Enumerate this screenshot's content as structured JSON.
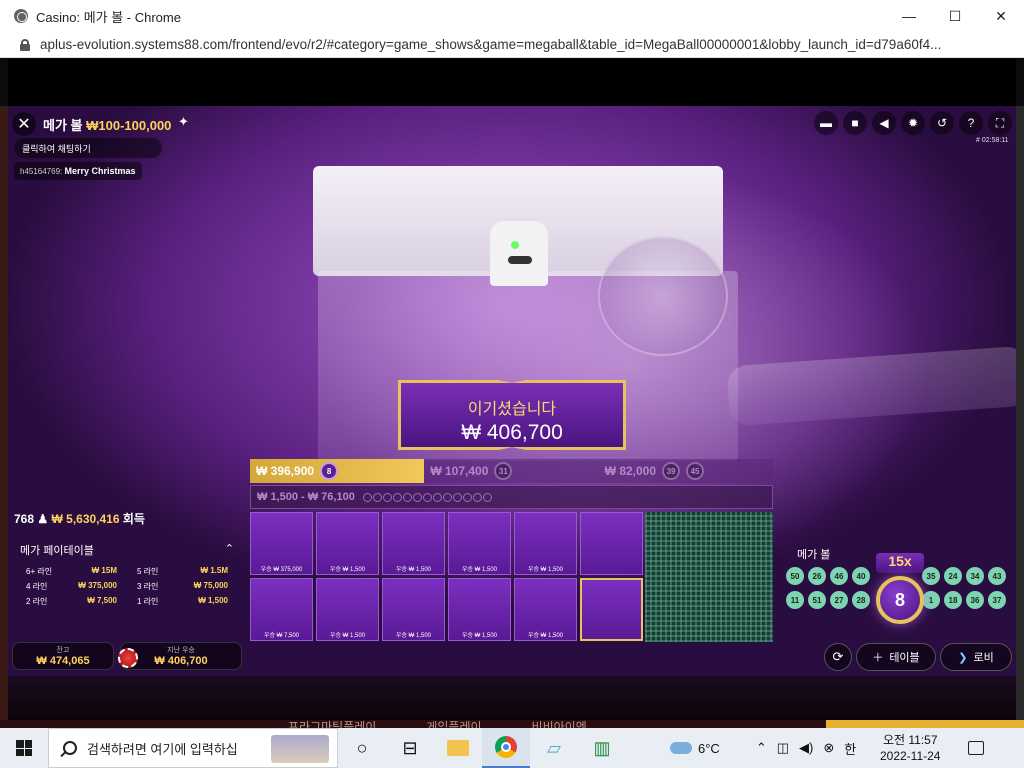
{
  "window": {
    "title": "Casino: 메가 볼 - Chrome",
    "url": "aplus-evolution.systems88.com/frontend/evo/r2/#category=game_shows&game=megaball&table_id=MegaBall00000001&lobby_launch_id=d79a60f4..."
  },
  "game": {
    "name": "메가 볼",
    "limits": "₩100-100,000",
    "round_id": "# 02:58:11",
    "chat_placeholder": "클릭하여 채팅하기",
    "chat_user": "h45164769:",
    "chat_text": "Merry Christmas"
  },
  "win": {
    "title": "이기셨습니다",
    "amount": "₩ 406,700"
  },
  "prizes": [
    {
      "amount": "₩ 396,900",
      "balls": [
        "8"
      ],
      "active": true
    },
    {
      "amount": "₩ 107,400",
      "balls": [
        "31"
      ],
      "active": false
    },
    {
      "amount": "₩ 82,000",
      "balls": [
        "39",
        "45"
      ],
      "active": false
    }
  ],
  "range": "₩ 1,500 - ₩ 76,100",
  "players": {
    "count": "768",
    "total": "₩ 5,630,416",
    "suffix": "회득"
  },
  "paytable": {
    "title": "메가 페이테이블",
    "rows": [
      {
        "label": "6+ 라인",
        "value": "₩ 15M"
      },
      {
        "label": "5 라인",
        "value": "₩ 1.5M"
      },
      {
        "label": "4 라인",
        "value": "₩ 375,000"
      },
      {
        "label": "3 라인",
        "value": "₩ 75,000"
      },
      {
        "label": "2 라인",
        "value": "₩ 7,500"
      },
      {
        "label": "1 라인",
        "value": "₩ 1,500"
      }
    ]
  },
  "balance": {
    "label": "잔고",
    "value": "₩ 474,065"
  },
  "last_win": {
    "label": "지난 우승",
    "value": "₩ 406,700"
  },
  "cards": [
    {
      "label": "우승 ₩ 375,000",
      "gold": false
    },
    {
      "label": "우승 ₩ 1,500",
      "gold": false
    },
    {
      "label": "우승 ₩ 1,500",
      "gold": false
    },
    {
      "label": "우승 ₩ 1,500",
      "gold": false
    },
    {
      "label": "우승 ₩ 1,500",
      "gold": false
    },
    {
      "label": "",
      "gold": false
    },
    {
      "label": "우승 ₩ 7,500",
      "gold": false
    },
    {
      "label": "우승 ₩ 1,500",
      "gold": false
    },
    {
      "label": "우승 ₩ 1,500",
      "gold": false
    },
    {
      "label": "우승 ₩ 1,500",
      "gold": false
    },
    {
      "label": "우승 ₩ 1,500",
      "gold": false
    },
    {
      "label": "",
      "gold": true
    }
  ],
  "mega_ball": {
    "label": "메가 볼",
    "multiplier": "15x",
    "number": "8",
    "balls": [
      "50",
      "26",
      "46",
      "40",
      "35",
      "24",
      "34",
      "43",
      "11",
      "51",
      "27",
      "28",
      "1",
      "18",
      "36",
      "37"
    ]
  },
  "buttons": {
    "table": "테이블",
    "lobby": "로비"
  },
  "under_links": [
    "프라그마틱플레이",
    "게임플레이",
    "비비아이엔"
  ],
  "taskbar": {
    "search_placeholder": "검색하려면 여기에 입력하십",
    "temperature": "6°C",
    "ime": "한",
    "time": "오전 11:57",
    "date": "2022-11-24"
  }
}
